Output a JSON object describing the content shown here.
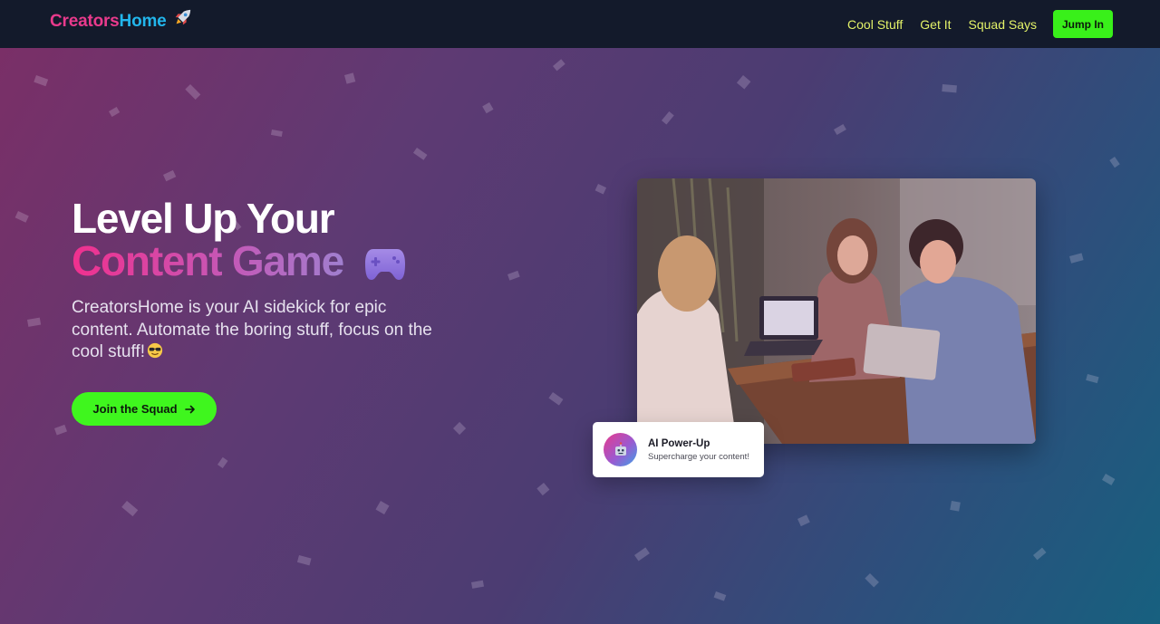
{
  "brand": {
    "part1": "Creators",
    "part2": "Home"
  },
  "nav": {
    "links": [
      "Cool Stuff",
      "Get It",
      "Squad Says"
    ],
    "cta": "Jump In"
  },
  "hero": {
    "title_line1": "Level Up Your",
    "title_line2": "Content Game",
    "description": "CreatorsHome is your AI sidekick for epic content. Automate the boring stuff, focus on the cool stuff!",
    "cta": "Join the Squad"
  },
  "card": {
    "title": "AI Power-Up",
    "subtitle": "Supercharge your content!"
  },
  "icons": [
    "rocket-icon",
    "gamepad-icon",
    "sunglasses-emoji-icon",
    "arrow-right-icon",
    "robot-icon"
  ],
  "colors": {
    "nav_bg": "#131a2b",
    "brand_pink": "#e93a8c",
    "brand_blue": "#22b6ec",
    "nav_link": "#e3f268",
    "accent_green": "#3ff61e"
  }
}
